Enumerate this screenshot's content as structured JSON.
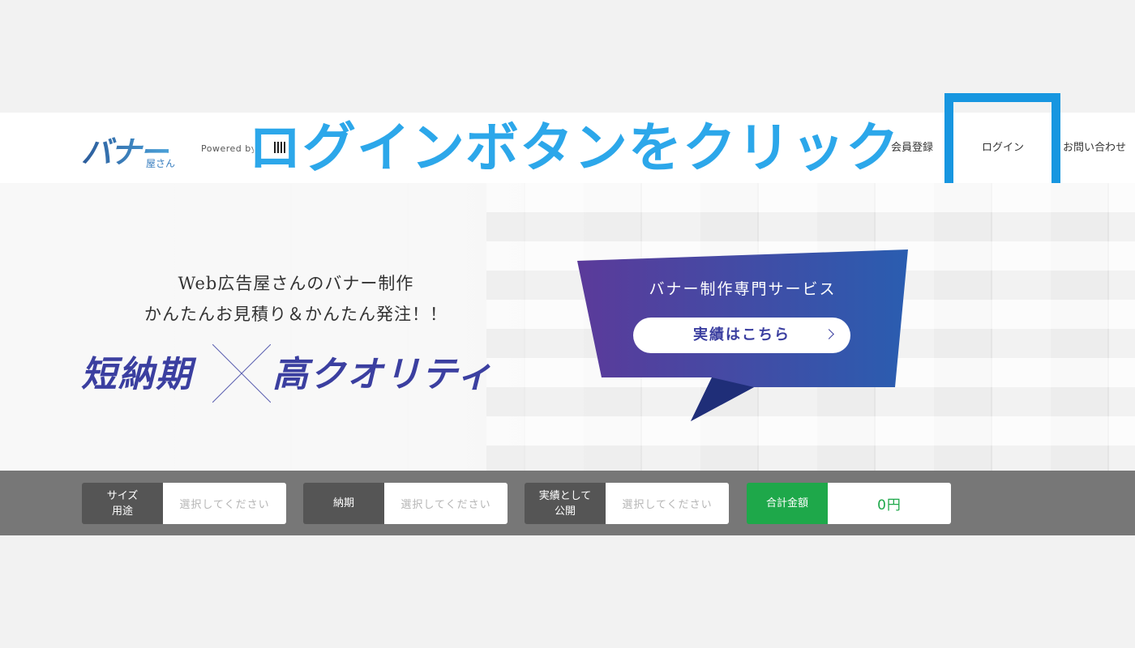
{
  "instruction": "ログインボタンをクリック",
  "header": {
    "logo_main": "バナー",
    "logo_sub": "屋さん",
    "powered_by": "Powered by",
    "nav": {
      "register": "会員登録",
      "login": "ログイン",
      "contact": "お問い合わせ"
    },
    "highlight_color": "#1796e0"
  },
  "hero": {
    "line1": "Web広告屋さんのバナー制作",
    "line2": "かんたんお見積り＆かんたん発注！！",
    "big_left": "短納期",
    "big_right": "高クオリティ",
    "banner_title": "バナー制作専門サービス",
    "banner_button": "実績はこちら"
  },
  "filters": {
    "size": {
      "label": "サイズ\n用途",
      "placeholder": "選択してください"
    },
    "deadline": {
      "label": "納期",
      "placeholder": "選択してください"
    },
    "portfolio": {
      "label": "実績として\n公開",
      "placeholder": "選択してください"
    },
    "total": {
      "label": "合計金額",
      "value": "0円"
    }
  },
  "colors": {
    "accent": "#2ca7ea",
    "brand_purple": "#3b3fa0",
    "total_green": "#1ea84a"
  }
}
